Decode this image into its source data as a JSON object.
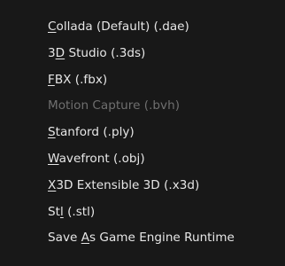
{
  "menu": {
    "items": [
      {
        "pre": "",
        "acc": "C",
        "post": "ollada (Default) (.dae)",
        "enabled": true
      },
      {
        "pre": "3",
        "acc": "D",
        "post": " Studio (.3ds)",
        "enabled": true
      },
      {
        "pre": "",
        "acc": "F",
        "post": "BX (.fbx)",
        "enabled": true
      },
      {
        "pre": "",
        "acc": "",
        "post": "Motion Capture (.bvh)",
        "enabled": false
      },
      {
        "pre": "",
        "acc": "S",
        "post": "tanford (.ply)",
        "enabled": true
      },
      {
        "pre": "",
        "acc": "W",
        "post": "avefront (.obj)",
        "enabled": true
      },
      {
        "pre": "",
        "acc": "X",
        "post": "3D Extensible 3D (.x3d)",
        "enabled": true
      },
      {
        "pre": "St",
        "acc": "l",
        "post": " (.stl)",
        "enabled": true
      },
      {
        "pre": "Save ",
        "acc": "A",
        "post": "s Game Engine Runtime",
        "enabled": true
      }
    ]
  }
}
